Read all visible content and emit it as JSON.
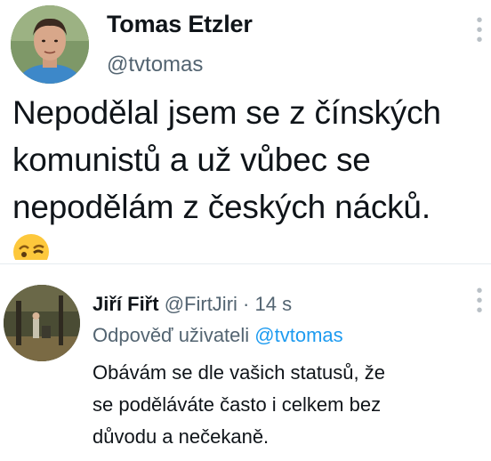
{
  "main_tweet": {
    "author_name": "Tomas Etzler",
    "author_handle": "@tvtomas",
    "text": "Nepodělal jsem se z čínských\nkomunistů a už vůbec se\nnepodělám z českých nácků.",
    "emoji": "winking-face"
  },
  "reply": {
    "author_name": "Jiří Fiřt",
    "author_handle": "@FirtJiri",
    "separator": "·",
    "time": "14 s",
    "replying_to_label": "Odpověď uživateli",
    "replying_to_handle": "@tvtomas",
    "text": "Obávám se dle vašich statusů, že\nse poděláváte často i celkem bez\ndůvodu a nečekaně."
  },
  "icons": {
    "more_menu": "more-vertical-icon"
  },
  "colors": {
    "text_primary": "#0f1419",
    "text_secondary": "#536471",
    "mention": "#1d9bf0",
    "divider": "#e6ecf0"
  }
}
